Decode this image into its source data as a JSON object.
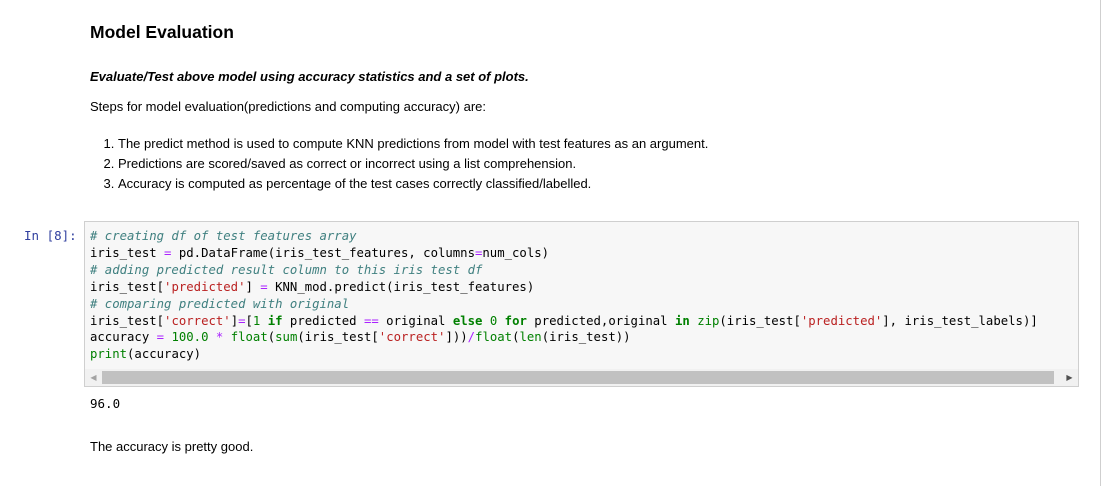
{
  "notebook": {
    "heading": "Model Evaluation",
    "subtitle": "Evaluate/Test above model using accuracy statistics and a set of plots.",
    "steps_intro": "Steps for model evaluation(predictions and computing accuracy) are:",
    "steps": [
      "The predict method is used to compute KNN predictions from model with test features as an argument.",
      "Predictions are scored/saved as correct or incorrect using a list comprehension.",
      "Accuracy is computed as percentage of the test cases correctly classified/labelled."
    ],
    "cell": {
      "prompt": "In [8]:",
      "code_lines": [
        "# creating df of test features array",
        "iris_test = pd.DataFrame(iris_test_features, columns=num_cols)",
        "# adding predicted result column to this iris test df",
        "iris_test['predicted'] = KNN_mod.predict(iris_test_features)",
        "# comparing predicted with original",
        "iris_test['correct']=[1 if predicted == original else 0 for predicted,original in zip(iris_test['predicted'], iris_test_labels)]",
        "accuracy = 100.0 * float(sum(iris_test['correct']))/float(len(iris_test))",
        "print(accuracy)"
      ],
      "output": "96.0"
    },
    "conclusion": "The accuracy is pretty good."
  },
  "icons": {
    "scroll_left": "scroll-left-arrow-icon",
    "scroll_right": "scroll-right-arrow-icon"
  },
  "colors": {
    "prompt": "#303f9f",
    "comment": "#408080",
    "string": "#ba2121",
    "keyword": "#008000",
    "operator": "#aa22ff"
  }
}
